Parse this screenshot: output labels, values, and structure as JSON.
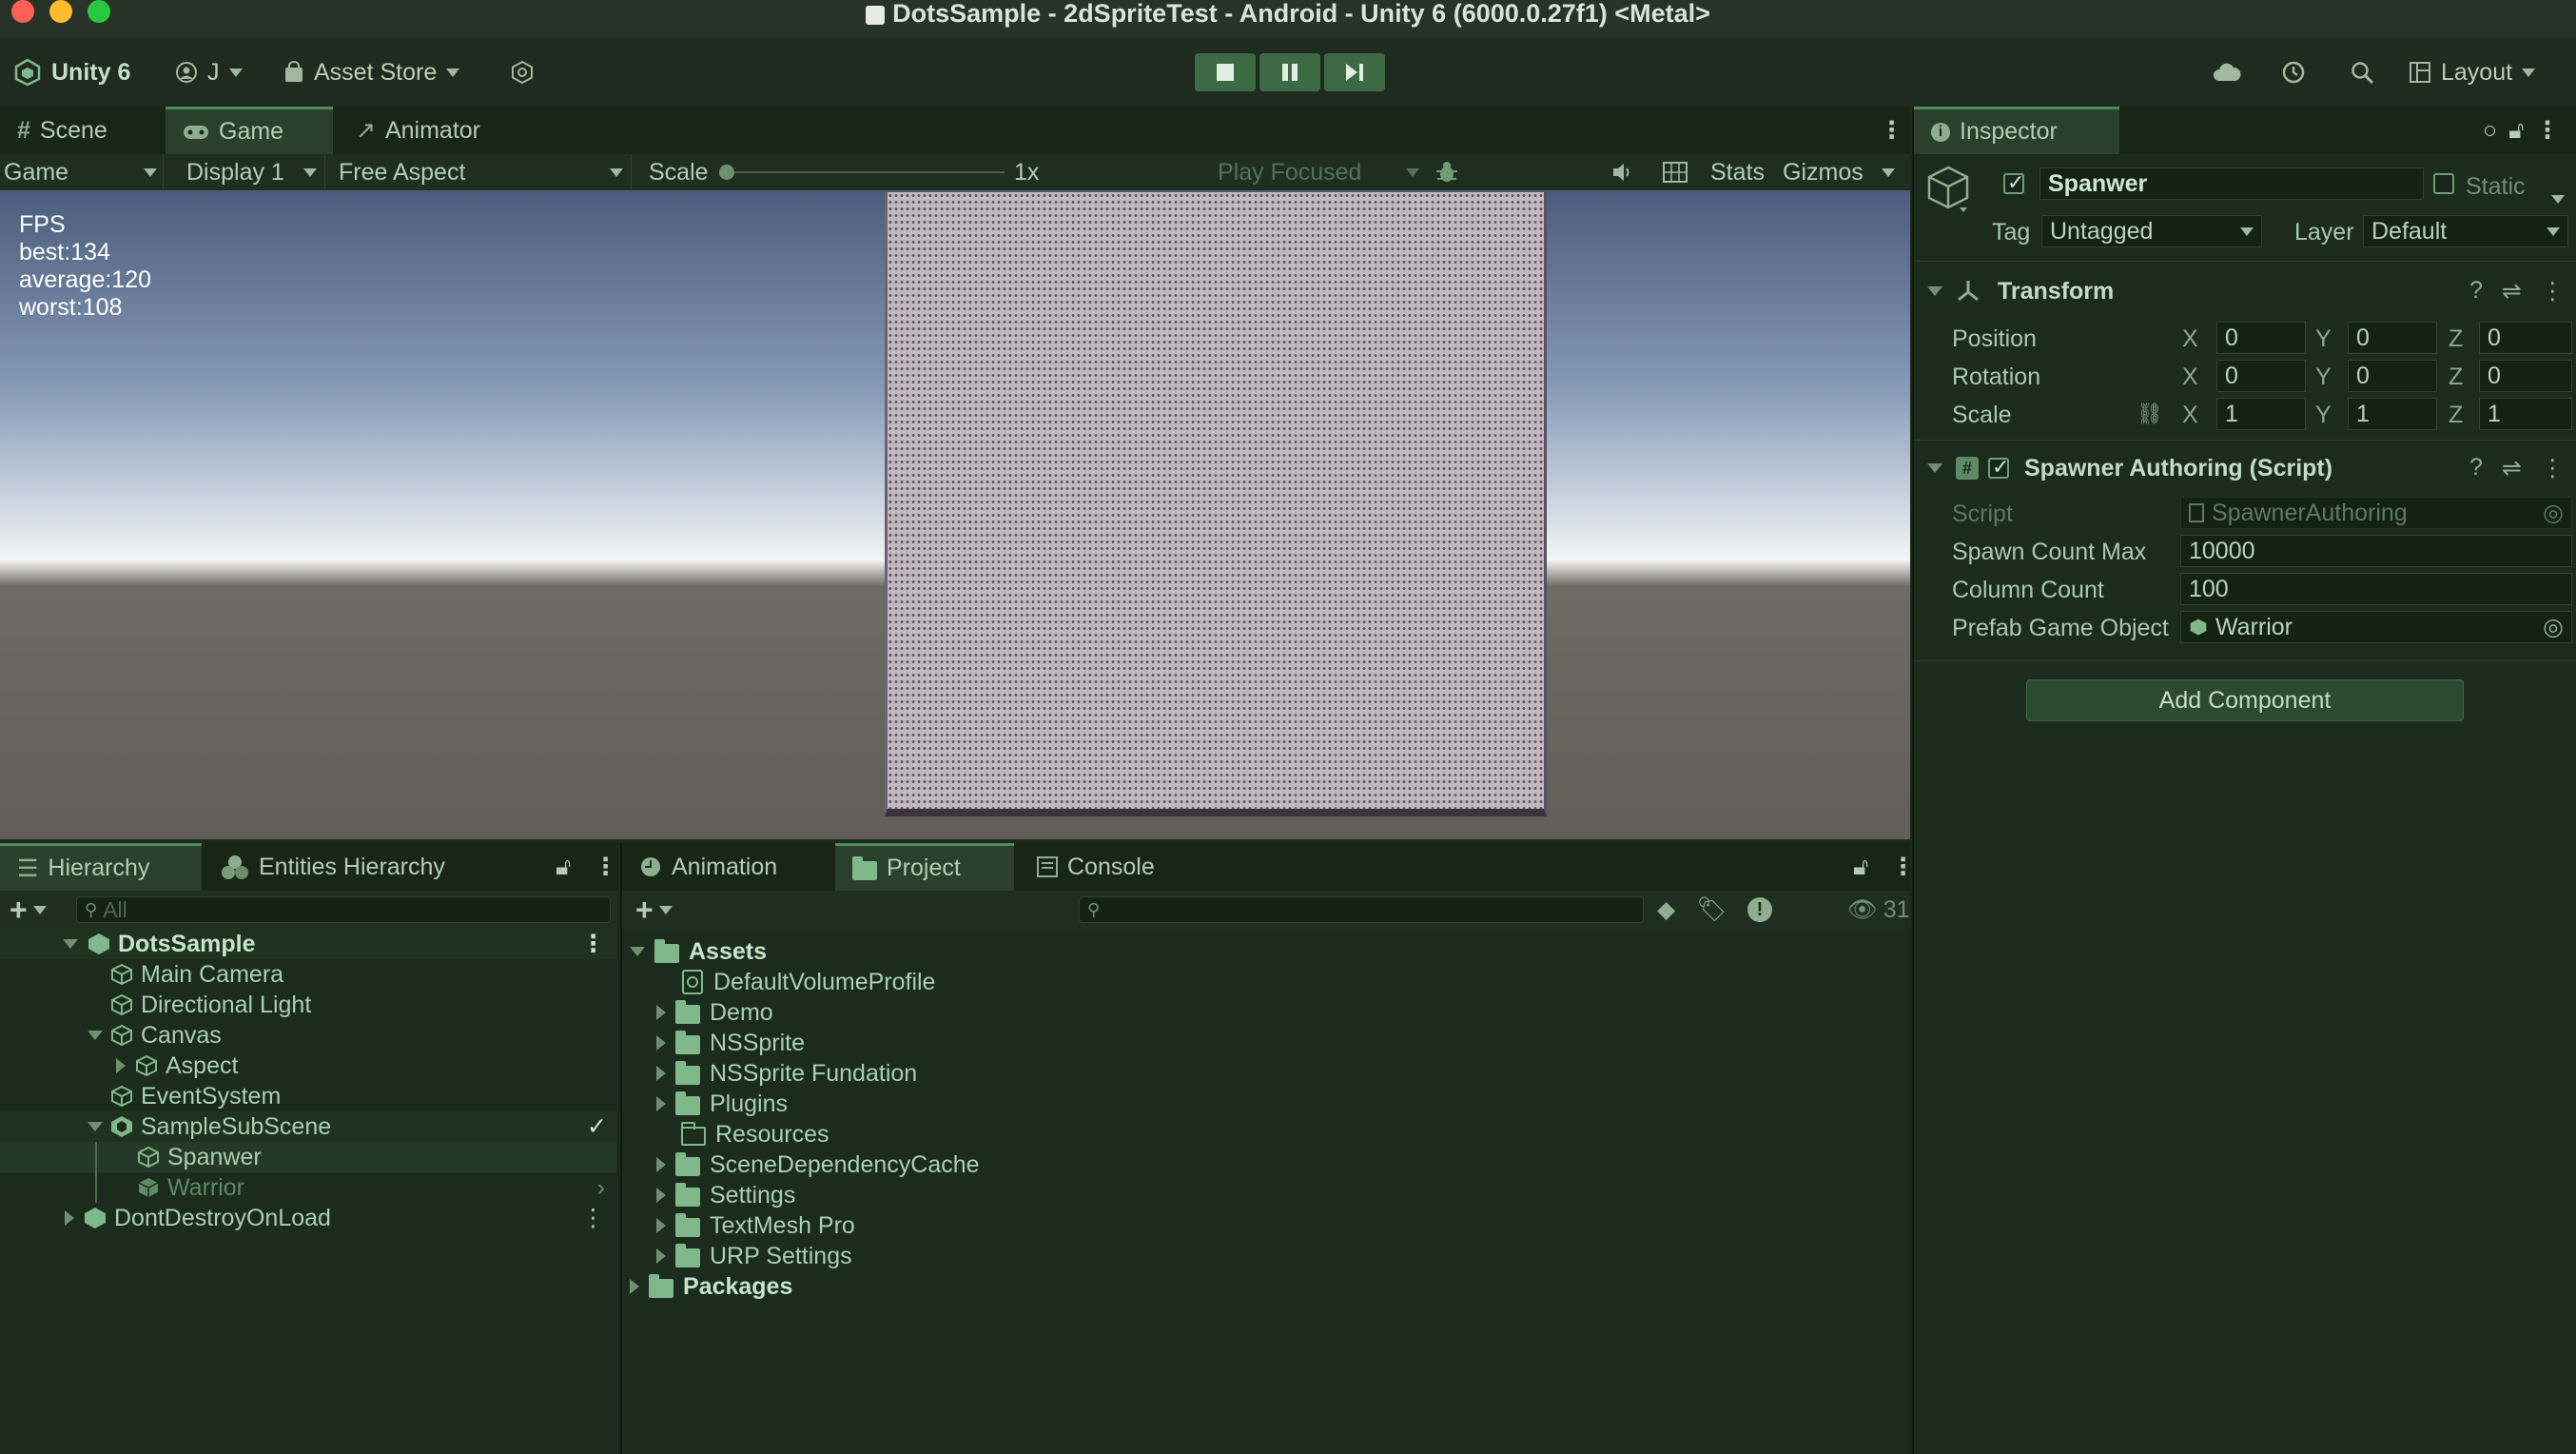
{
  "window": {
    "title": "DotsSample - 2dSpriteTest - Android - Unity 6 (6000.0.27f1) <Metal>"
  },
  "toolbar": {
    "app_label": "Unity 6",
    "account_label": "J",
    "asset_store_label": "Asset Store",
    "layout_label": "Layout"
  },
  "top_tabs": [
    "Scene",
    "Game",
    "Animator"
  ],
  "game_view": {
    "mode": "Game",
    "display": "Display 1",
    "aspect": "Free Aspect",
    "scale_label": "Scale",
    "scale_value": "1x",
    "play_focused": "Play Focused",
    "stats_label": "Stats",
    "gizmos_label": "Gizmos",
    "fps": {
      "title": "FPS",
      "best": "best:134",
      "average": "average:120",
      "worst": "worst:108"
    }
  },
  "hierarchy": {
    "tabs": [
      "Hierarchy",
      "Entities Hierarchy"
    ],
    "search_placeholder": "All",
    "rows": [
      "DotsSample",
      "Main Camera",
      "Directional Light",
      "Canvas",
      "Aspect",
      "EventSystem",
      "SampleSubScene",
      "Spanwer",
      "Warrior",
      "DontDestroyOnLoad"
    ]
  },
  "project": {
    "tabs": [
      "Animation",
      "Project",
      "Console"
    ],
    "hidden_count": "31",
    "rows": [
      "Assets",
      "DefaultVolumeProfile",
      "Demo",
      "NSSprite",
      "NSSprite Fundation",
      "Plugins",
      "Resources",
      "SceneDependencyCache",
      "Settings",
      "TextMesh Pro",
      "URP Settings",
      "Packages"
    ]
  },
  "inspector": {
    "tab_label": "Inspector",
    "object_name": "Spanwer",
    "static_label": "Static",
    "tag_label": "Tag",
    "tag_value": "Untagged",
    "layer_label": "Layer",
    "layer_value": "Default",
    "transform": {
      "title": "Transform",
      "rows": [
        {
          "label": "Position",
          "x": "0",
          "y": "0",
          "z": "0"
        },
        {
          "label": "Rotation",
          "x": "0",
          "y": "0",
          "z": "0"
        },
        {
          "label": "Scale",
          "x": "1",
          "y": "1",
          "z": "1"
        }
      ],
      "axis": [
        "X",
        "Y",
        "Z"
      ]
    },
    "spawner": {
      "title": "Spawner Authoring (Script)",
      "script_label": "Script",
      "script_value": "SpawnerAuthoring",
      "spawn_count_label": "Spawn Count Max",
      "spawn_count_value": "10000",
      "column_count_label": "Column Count",
      "column_count_value": "100",
      "prefab_label": "Prefab Game Object",
      "prefab_value": "Warrior"
    },
    "add_component_label": "Add Component"
  },
  "colors": {
    "accent": "#4e8a56",
    "play_button": "#3c6a44",
    "panel_bg": "#1b2b1c"
  }
}
